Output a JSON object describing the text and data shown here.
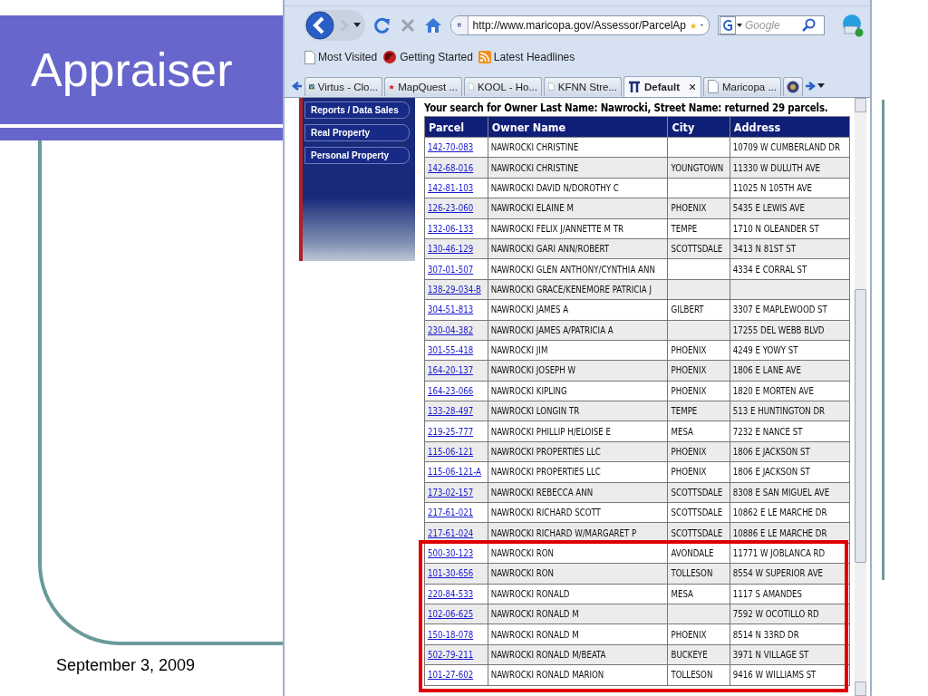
{
  "slide": {
    "title": "Appraiser",
    "date": "September 3, 2009"
  },
  "browser": {
    "address": "http://www.maricopa.gov/Assessor/ParcelAp",
    "search_placeholder": "Google",
    "bookmarks": [
      {
        "label": "Most Visited",
        "kind": "page"
      },
      {
        "label": "Getting Started",
        "kind": "fox"
      },
      {
        "label": "Latest Headlines",
        "kind": "rss"
      }
    ],
    "tabs": [
      {
        "label": "Virtus - Clo...",
        "kind": "v",
        "selected": false
      },
      {
        "label": "MapQuest ...",
        "kind": "star",
        "selected": false
      },
      {
        "label": "KOOL - Ho...",
        "kind": "page",
        "selected": false
      },
      {
        "label": "KFNN Stre...",
        "kind": "page",
        "selected": false
      },
      {
        "label": "Default",
        "kind": "site",
        "selected": true
      },
      {
        "label": "Maricopa ...",
        "kind": "page",
        "selected": false
      }
    ],
    "tab_close": "×"
  },
  "page": {
    "nav": [
      "Reports / Data Sales",
      "Real Property",
      "Personal Property"
    ],
    "heading": "Your search for Owner Last Name: Nawrocki, Street Name: returned 29 parcels.",
    "table": {
      "columns": [
        "Parcel",
        "Owner Name",
        "City",
        "Address"
      ],
      "rows": [
        {
          "cells": [
            "142-70-083",
            "NAWROCKI CHRISTINE",
            "",
            "10709 W CUMBERLAND DR"
          ],
          "highlighted": false
        },
        {
          "cells": [
            "142-68-016",
            "NAWROCKI CHRISTINE",
            "YOUNGTOWN",
            "11330 W DULUTH AVE"
          ],
          "highlighted": false
        },
        {
          "cells": [
            "142-81-103",
            "NAWROCKI DAVID N/DOROTHY C",
            "",
            "11025 N 105TH AVE"
          ],
          "highlighted": false
        },
        {
          "cells": [
            "126-23-060",
            "NAWROCKI ELAINE M",
            "PHOENIX",
            "5435 E LEWIS AVE"
          ],
          "highlighted": false
        },
        {
          "cells": [
            "132-06-133",
            "NAWROCKI FELIX J/ANNETTE M TR",
            "TEMPE",
            "1710 N OLEANDER ST"
          ],
          "highlighted": false
        },
        {
          "cells": [
            "130-46-129",
            "NAWROCKI GARI ANN/ROBERT",
            "SCOTTSDALE",
            "3413 N 81ST ST"
          ],
          "highlighted": false
        },
        {
          "cells": [
            "307-01-507",
            "NAWROCKI GLEN ANTHONY/CYNTHIA ANN",
            "",
            "4334 E CORRAL ST"
          ],
          "highlighted": false
        },
        {
          "cells": [
            "138-29-034-B",
            "NAWROCKI GRACE/KENEMORE PATRICIA J",
            "",
            ""
          ],
          "highlighted": false
        },
        {
          "cells": [
            "304-51-813",
            "NAWROCKI JAMES A",
            "GILBERT",
            "3307 E MAPLEWOOD ST"
          ],
          "highlighted": false
        },
        {
          "cells": [
            "230-04-382",
            "NAWROCKI JAMES A/PATRICIA A",
            "",
            "17255 DEL WEBB BLVD"
          ],
          "highlighted": false
        },
        {
          "cells": [
            "301-55-418",
            "NAWROCKI JIM",
            "PHOENIX",
            "4249 E YOWY ST"
          ],
          "highlighted": false
        },
        {
          "cells": [
            "164-20-137",
            "NAWROCKI JOSEPH W",
            "PHOENIX",
            "1806 E LANE AVE"
          ],
          "highlighted": false
        },
        {
          "cells": [
            "164-23-066",
            "NAWROCKI KIPLING",
            "PHOENIX",
            "1820 E MORTEN AVE"
          ],
          "highlighted": false
        },
        {
          "cells": [
            "133-28-497",
            "NAWROCKI LONGIN TR",
            "TEMPE",
            "513 E HUNTINGTON DR"
          ],
          "highlighted": false
        },
        {
          "cells": [
            "219-25-777",
            "NAWROCKI PHILLIP H/ELOISE E",
            "MESA",
            "7232 E NANCE ST"
          ],
          "highlighted": false
        },
        {
          "cells": [
            "115-06-121",
            "NAWROCKI PROPERTIES LLC",
            "PHOENIX",
            "1806 E JACKSON ST"
          ],
          "highlighted": false
        },
        {
          "cells": [
            "115-06-121-A",
            "NAWROCKI PROPERTIES LLC",
            "PHOENIX",
            "1806 E JACKSON ST"
          ],
          "highlighted": false
        },
        {
          "cells": [
            "173-02-157",
            "NAWROCKI REBECCA ANN",
            "SCOTTSDALE",
            "8308 E SAN MIGUEL AVE"
          ],
          "highlighted": false
        },
        {
          "cells": [
            "217-61-021",
            "NAWROCKI RICHARD SCOTT",
            "SCOTTSDALE",
            "10862 E LE MARCHE DR"
          ],
          "highlighted": false
        },
        {
          "cells": [
            "217-61-024",
            "NAWROCKI RICHARD W/MARGARET P",
            "SCOTTSDALE",
            "10886 E LE MARCHE DR"
          ],
          "highlighted": false
        },
        {
          "cells": [
            "500-30-123",
            "NAWROCKI RON",
            "AVONDALE",
            "11771 W JOBLANCA RD"
          ],
          "highlighted": true
        },
        {
          "cells": [
            "101-30-656",
            "NAWROCKI RON",
            "TOLLESON",
            "8554 W SUPERIOR AVE"
          ],
          "highlighted": true
        },
        {
          "cells": [
            "220-84-533",
            "NAWROCKI RONALD",
            "MESA",
            "1117 S AMANDES"
          ],
          "highlighted": true
        },
        {
          "cells": [
            "102-06-625",
            "NAWROCKI RONALD M",
            "",
            "7592 W OCOTILLO RD"
          ],
          "highlighted": true
        },
        {
          "cells": [
            "150-18-078",
            "NAWROCKI RONALD M",
            "PHOENIX",
            "8514 N 33RD DR"
          ],
          "highlighted": true
        },
        {
          "cells": [
            "502-79-211",
            "NAWROCKI RONALD M/BEATA",
            "BUCKEYE",
            "3971 N VILLAGE ST"
          ],
          "highlighted": true
        },
        {
          "cells": [
            "101-27-602",
            "NAWROCKI RONALD MARION",
            "TOLLESON",
            "9416 W WILLIAMS ST"
          ],
          "highlighted": true
        }
      ]
    }
  }
}
